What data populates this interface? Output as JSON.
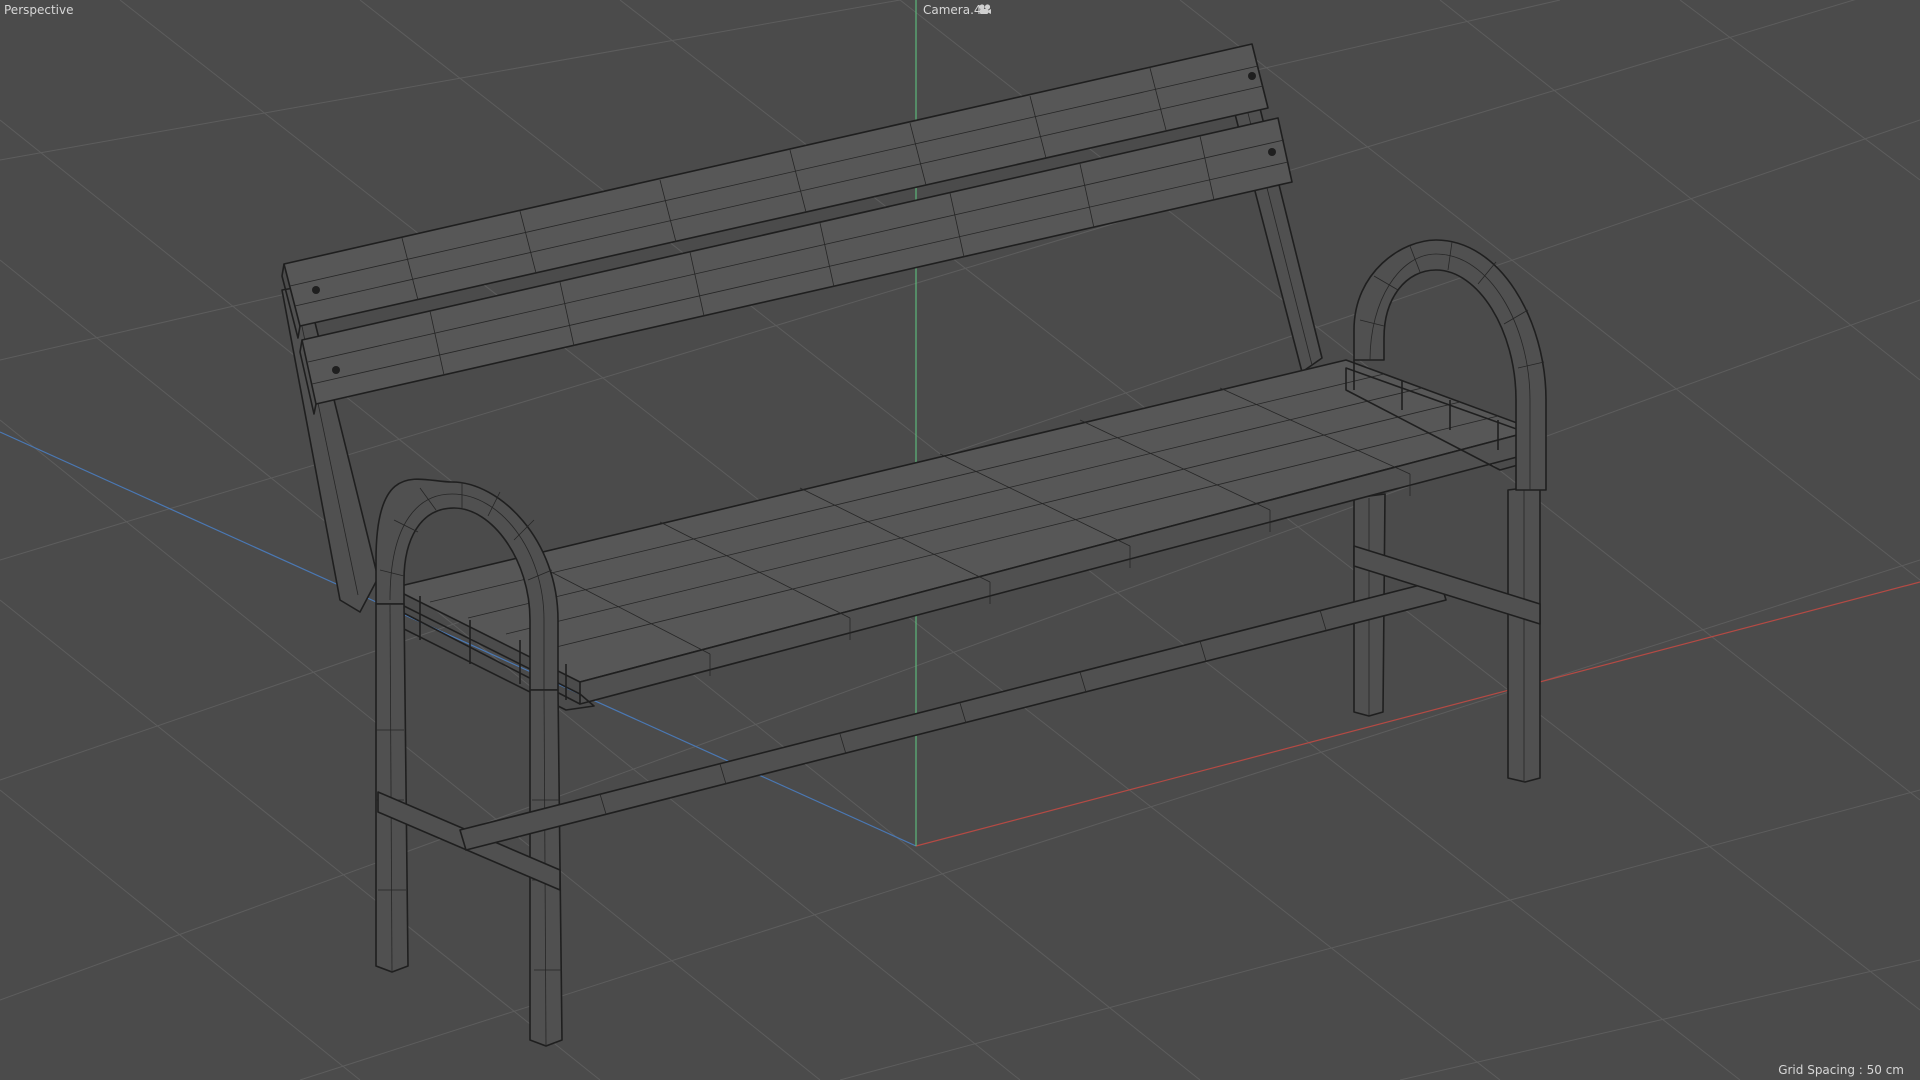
{
  "viewport": {
    "view_name": "Perspective",
    "camera_name": "Camera.4",
    "grid_spacing_label": "Grid Spacing : 50 cm"
  },
  "axes": {
    "x_color": "#b44a44",
    "y_color": "#5cb87a",
    "z_color": "#4a78b4"
  },
  "icons": {
    "camera": "camera-icon"
  }
}
